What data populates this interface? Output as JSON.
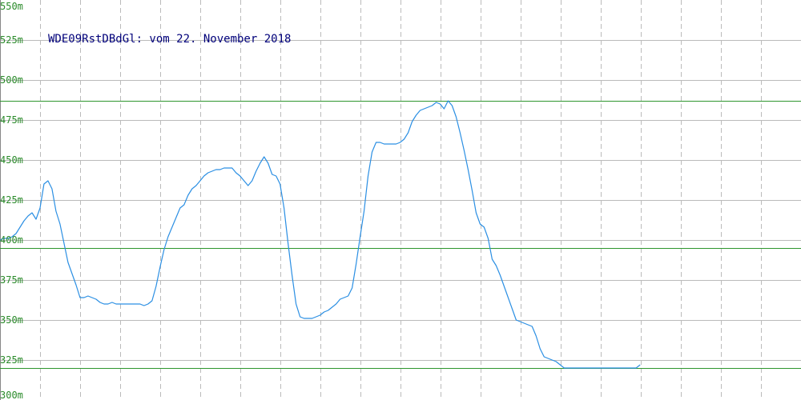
{
  "chart_data": {
    "type": "line",
    "title": "WDE09RstDBdGl: vom 22. November 2018",
    "xlabel": "",
    "ylabel": "",
    "ylim": [
      300,
      550
    ],
    "y_ticks": [
      "550m",
      "525m",
      "500m",
      "475m",
      "450m",
      "425m",
      "400m",
      "375m",
      "350m",
      "325m",
      "300m"
    ],
    "y_tick_values": [
      550,
      525,
      500,
      475,
      450,
      425,
      400,
      375,
      350,
      325,
      300
    ],
    "grid": true,
    "reference_lines": [
      487,
      395,
      320
    ],
    "x": [
      0,
      5,
      10,
      15,
      20,
      25,
      30,
      35,
      40,
      45,
      50,
      55,
      60,
      65,
      70,
      75,
      80,
      85,
      90,
      95,
      100,
      105,
      110,
      115,
      120,
      125,
      130,
      135,
      140,
      145,
      150,
      155,
      160,
      165,
      170,
      175,
      180,
      185,
      190,
      195,
      200,
      205,
      210,
      215,
      220,
      225,
      230,
      235,
      240,
      245,
      250,
      255,
      260,
      265,
      270,
      275,
      280,
      285,
      290,
      295,
      300,
      305,
      310,
      315,
      320,
      325,
      330,
      335,
      340,
      345,
      350,
      355,
      360,
      365,
      370,
      375,
      380,
      385,
      390,
      395,
      400,
      405,
      410,
      415,
      420,
      425,
      430,
      435,
      440,
      445,
      450,
      455,
      460,
      465,
      470,
      475,
      480,
      485,
      490,
      495,
      500,
      505,
      510,
      515,
      520,
      525,
      530,
      535,
      540,
      545,
      550,
      555,
      560,
      565,
      570,
      575,
      580,
      585,
      590,
      595,
      600,
      605,
      610,
      615,
      620,
      625,
      630,
      635,
      640,
      645,
      650,
      655,
      660,
      665,
      670,
      675,
      680,
      685,
      690,
      695,
      700,
      705,
      710,
      715,
      720,
      725,
      730,
      735,
      740,
      745,
      750,
      755,
      760,
      765,
      770,
      775,
      780,
      785,
      790,
      795,
      800,
      805,
      810,
      815,
      820,
      825,
      830,
      835,
      840,
      845,
      850,
      855,
      860,
      865,
      870,
      875,
      880,
      885,
      890,
      895,
      900,
      905,
      910,
      915,
      920,
      925,
      930,
      935,
      940,
      945,
      950,
      955,
      960,
      965,
      970,
      975,
      980,
      985,
      990,
      995,
      1000
    ],
    "series": [
      {
        "values": [
          400,
          401,
          401,
          402,
          404,
          408,
          412,
          415,
          417,
          413,
          420,
          435,
          437,
          432,
          418,
          410,
          398,
          386,
          379,
          372,
          364,
          364,
          365,
          364,
          363,
          361,
          360,
          360,
          361,
          360,
          360,
          360,
          360,
          360,
          360,
          360,
          359,
          360,
          362,
          371,
          383,
          394,
          402,
          408,
          414,
          420,
          422,
          428,
          432,
          434,
          437,
          440,
          442,
          443,
          444,
          444,
          445,
          445,
          445,
          442,
          440,
          437,
          434,
          437,
          443,
          448,
          452,
          448,
          441,
          440,
          435,
          420,
          398,
          378,
          360,
          352,
          351,
          351,
          351,
          352,
          353,
          355,
          356,
          358,
          360,
          363,
          364,
          365,
          370,
          385,
          402,
          418,
          440,
          455,
          461,
          461,
          460,
          460,
          460,
          460,
          461,
          463,
          467,
          474,
          478,
          481,
          482,
          483,
          484,
          486,
          485,
          482,
          487,
          484,
          477,
          467,
          456,
          444,
          431,
          417,
          410,
          408,
          401,
          388,
          384,
          378,
          371,
          364,
          357,
          350,
          349,
          348,
          347,
          346,
          340,
          332,
          327,
          326,
          325,
          324,
          322,
          320,
          320,
          320,
          320,
          320,
          320,
          320,
          320,
          320,
          320,
          320,
          320,
          320,
          320,
          320,
          320,
          320,
          320,
          320,
          322
        ]
      }
    ],
    "color": "#2b8fe3",
    "grid_color": "#bbbbbb",
    "reference_line_color": "#2e962e",
    "axis_label_color": "#2a8a2a",
    "title_color": "#00007a"
  }
}
